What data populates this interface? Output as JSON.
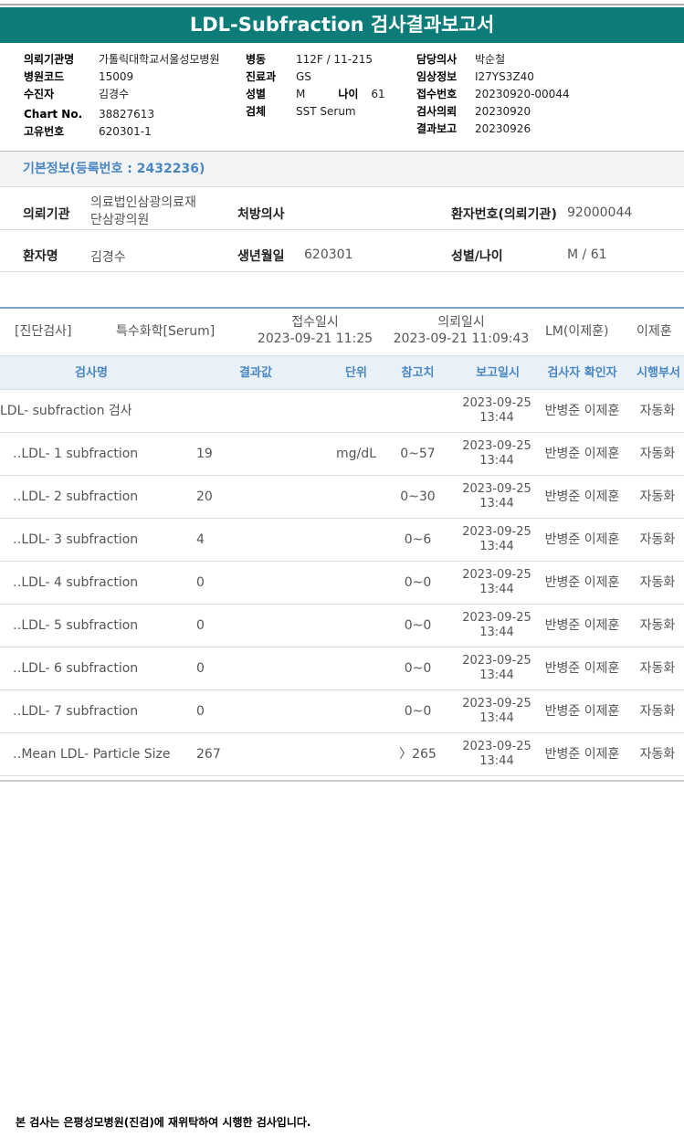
{
  "title": "LDL-Subfraction 검사결과보고서",
  "info": {
    "col1": [
      {
        "k": "의뢰기관명",
        "v": "가톨릭대학교서울성모병원"
      },
      {
        "k": "병원코드",
        "v": "15009"
      },
      {
        "k": "수진자",
        "v": "김경수"
      },
      {
        "k": "Chart No.",
        "v": "38827613"
      },
      {
        "k": "고유번호",
        "v": "620301-1"
      }
    ],
    "col2": [
      {
        "k": "병동",
        "v": "112F / 11-215"
      },
      {
        "k": "진료과",
        "v": "GS"
      },
      {
        "k": "성별",
        "v": "M",
        "k2": "나이",
        "v2": "61"
      },
      {
        "k": "검체",
        "v": "SST Serum"
      }
    ],
    "col3": [
      {
        "k": "담당의사",
        "v": "박순철"
      },
      {
        "k": "임상정보",
        "v": "I27YS3Z40"
      },
      {
        "k": "접수번호",
        "v": "20230920-00044"
      },
      {
        "k": "검사의뢰",
        "v": "20230920"
      },
      {
        "k": "결과보고",
        "v": "20230926"
      }
    ]
  },
  "basic": {
    "header": "기본정보(등록번호 : 2432236)",
    "inst_label": "의뢰기관",
    "inst_line1": "의료법인삼광의료재",
    "inst_line2": "단삼광의원",
    "doctor_label": "처방의사",
    "pid_label": "환자번호(의뢰기관)",
    "pid": "92000044",
    "name_label": "환자명",
    "name": "김경수",
    "dob_label": "생년월일",
    "dob": "620301",
    "sex_label": "성별/나이",
    "sex": "M / 61"
  },
  "order": {
    "category": "[진단검사]",
    "type": "특수화학[Serum]",
    "recv_label": "접수일시",
    "recv": "2023-09-21 11:25",
    "req_label": "의뢰일시",
    "req": "2023-09-21 11:09:43",
    "lm": "LM(이제훈)",
    "person": "이제훈"
  },
  "table": {
    "headers": [
      "검사명",
      "결과값",
      "단위",
      "참고치",
      "보고일시",
      "검사자 확인자",
      "시행부서"
    ],
    "rows": [
      {
        "name": "LDL- subfraction 검사",
        "value": "",
        "unit": "",
        "ref": "",
        "date": "2023-09-25",
        "time": "13:44",
        "checker": "반병준 이제훈",
        "dept": "자동화"
      },
      {
        "name": "‥LDL- 1 subfraction",
        "value": "19",
        "unit": "mg/dL",
        "ref": "0~57",
        "date": "2023-09-25",
        "time": "13:44",
        "checker": "반병준 이제훈",
        "dept": "자동화"
      },
      {
        "name": "‥LDL- 2 subfraction",
        "value": "20",
        "unit": "",
        "ref": "0~30",
        "date": "2023-09-25",
        "time": "13:44",
        "checker": "반병준 이제훈",
        "dept": "자동화"
      },
      {
        "name": "‥LDL- 3 subfraction",
        "value": "4",
        "unit": "",
        "ref": "0~6",
        "date": "2023-09-25",
        "time": "13:44",
        "checker": "반병준 이제훈",
        "dept": "자동화"
      },
      {
        "name": "‥LDL- 4 subfraction",
        "value": "0",
        "unit": "",
        "ref": "0~0",
        "date": "2023-09-25",
        "time": "13:44",
        "checker": "반병준 이제훈",
        "dept": "자동화"
      },
      {
        "name": "‥LDL- 5 subfraction",
        "value": "0",
        "unit": "",
        "ref": "0~0",
        "date": "2023-09-25",
        "time": "13:44",
        "checker": "반병준 이제훈",
        "dept": "자동화"
      },
      {
        "name": "‥LDL- 6 subfraction",
        "value": "0",
        "unit": "",
        "ref": "0~0",
        "date": "2023-09-25",
        "time": "13:44",
        "checker": "반병준 이제훈",
        "dept": "자동화"
      },
      {
        "name": "‥LDL- 7 subfraction",
        "value": "0",
        "unit": "",
        "ref": "0~0",
        "date": "2023-09-25",
        "time": "13:44",
        "checker": "반병준 이제훈",
        "dept": "자동화"
      },
      {
        "name": "‥Mean LDL- Particle Size",
        "value": "267",
        "unit": "",
        "ref": "〉265",
        "date": "2023-09-25",
        "time": "13:44",
        "checker": "반병준 이제훈",
        "dept": "자동화"
      }
    ]
  },
  "footer": "본 검사는 은평성모병원(진검)에 재위탁하여 시행한 검사입니다."
}
